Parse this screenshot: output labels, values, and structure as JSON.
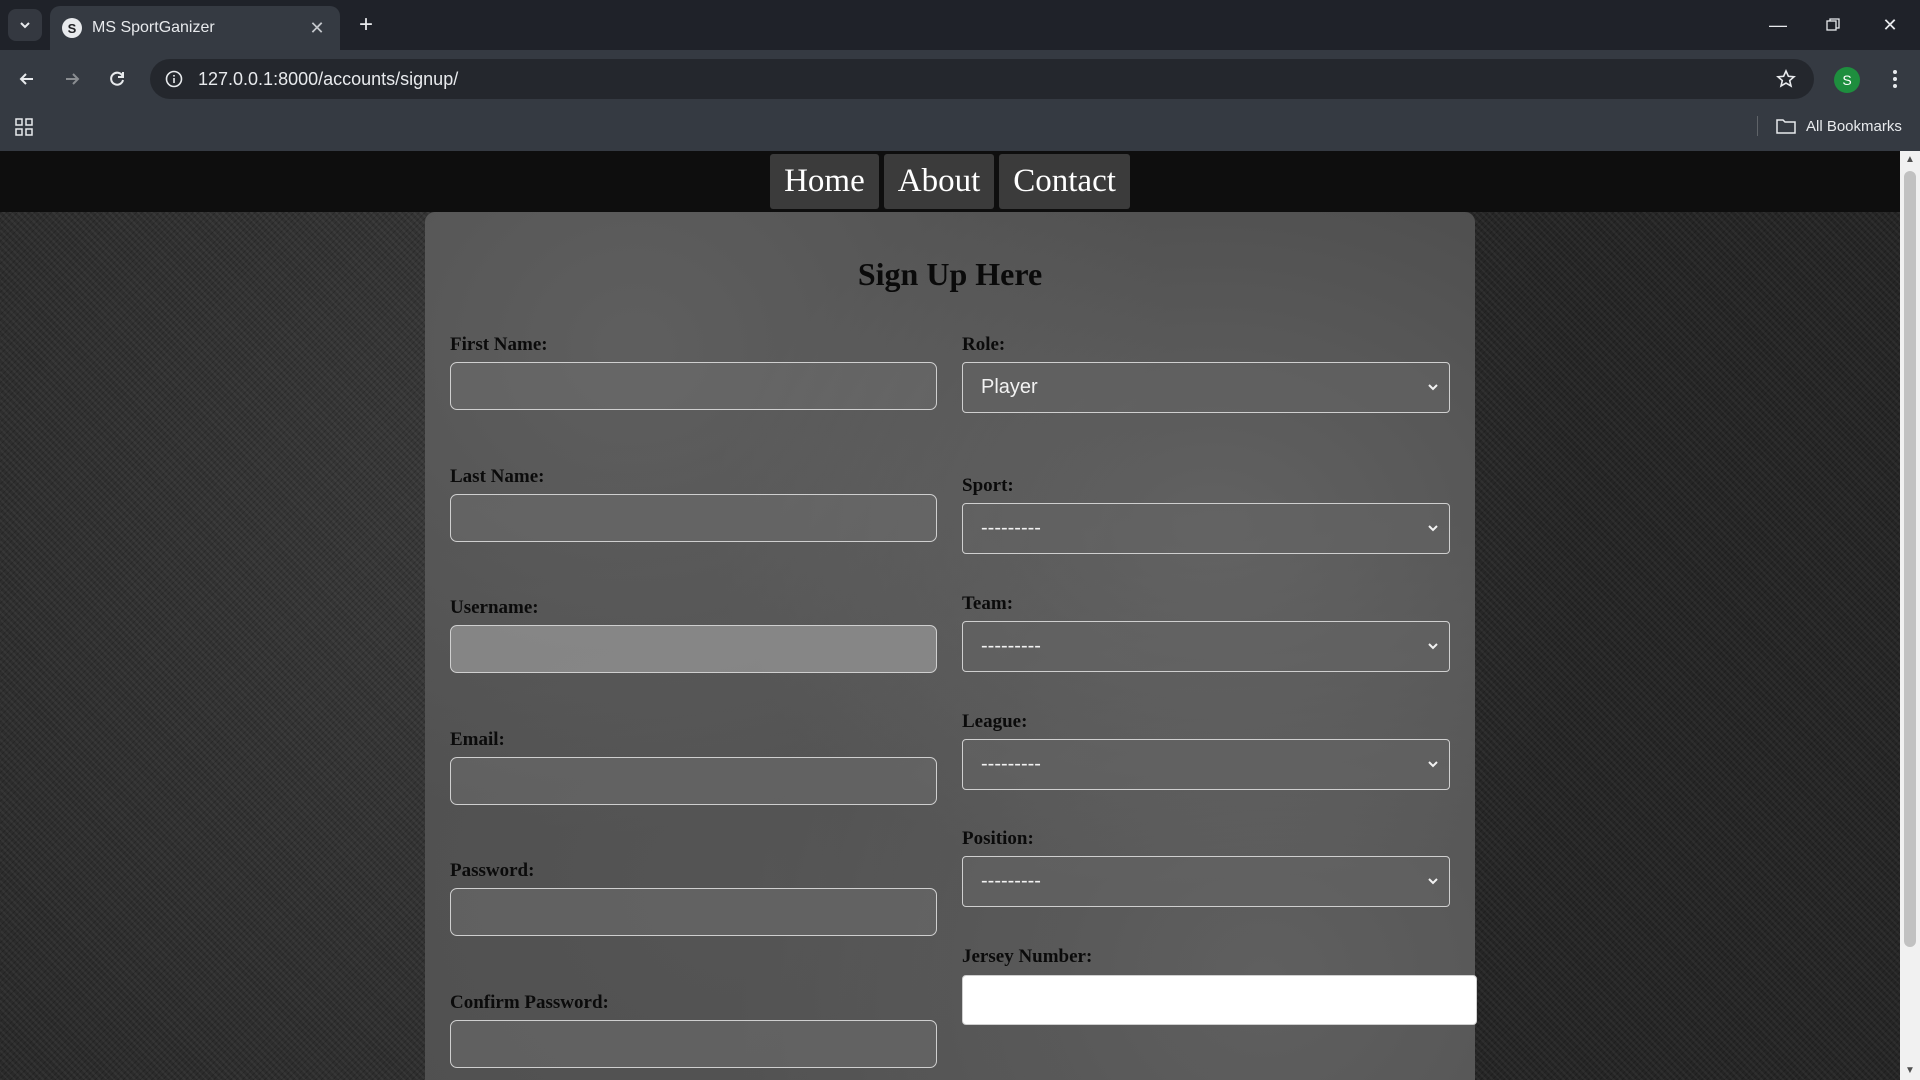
{
  "browser": {
    "tab_title": "MS SportGanizer",
    "favicon_letter": "S",
    "url": "127.0.0.1:8000/accounts/signup/",
    "profile_initial": "S",
    "all_bookmarks": "All Bookmarks"
  },
  "nav": {
    "home": "Home",
    "about": "About",
    "contact": "Contact"
  },
  "form": {
    "title": "Sign Up Here",
    "labels": {
      "first_name": "First Name:",
      "last_name": "Last Name:",
      "username": "Username:",
      "email": "Email:",
      "password": "Password:",
      "confirm_password": "Confirm Password:",
      "role": "Role:",
      "sport": "Sport:",
      "team": "Team:",
      "league": "League:",
      "position": "Position:",
      "jersey_number": "Jersey Number:"
    },
    "values": {
      "role": "Player",
      "sport": "---------",
      "team": "---------",
      "league": "---------",
      "position": "---------"
    }
  }
}
